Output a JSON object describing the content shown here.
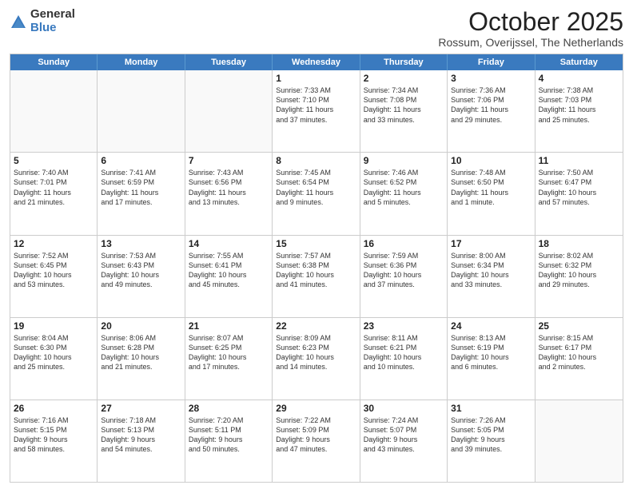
{
  "logo": {
    "general": "General",
    "blue": "Blue"
  },
  "title": "October 2025",
  "location": "Rossum, Overijssel, The Netherlands",
  "header_days": [
    "Sunday",
    "Monday",
    "Tuesday",
    "Wednesday",
    "Thursday",
    "Friday",
    "Saturday"
  ],
  "weeks": [
    [
      {
        "day": "",
        "text": ""
      },
      {
        "day": "",
        "text": ""
      },
      {
        "day": "",
        "text": ""
      },
      {
        "day": "1",
        "text": "Sunrise: 7:33 AM\nSunset: 7:10 PM\nDaylight: 11 hours\nand 37 minutes."
      },
      {
        "day": "2",
        "text": "Sunrise: 7:34 AM\nSunset: 7:08 PM\nDaylight: 11 hours\nand 33 minutes."
      },
      {
        "day": "3",
        "text": "Sunrise: 7:36 AM\nSunset: 7:06 PM\nDaylight: 11 hours\nand 29 minutes."
      },
      {
        "day": "4",
        "text": "Sunrise: 7:38 AM\nSunset: 7:03 PM\nDaylight: 11 hours\nand 25 minutes."
      }
    ],
    [
      {
        "day": "5",
        "text": "Sunrise: 7:40 AM\nSunset: 7:01 PM\nDaylight: 11 hours\nand 21 minutes."
      },
      {
        "day": "6",
        "text": "Sunrise: 7:41 AM\nSunset: 6:59 PM\nDaylight: 11 hours\nand 17 minutes."
      },
      {
        "day": "7",
        "text": "Sunrise: 7:43 AM\nSunset: 6:56 PM\nDaylight: 11 hours\nand 13 minutes."
      },
      {
        "day": "8",
        "text": "Sunrise: 7:45 AM\nSunset: 6:54 PM\nDaylight: 11 hours\nand 9 minutes."
      },
      {
        "day": "9",
        "text": "Sunrise: 7:46 AM\nSunset: 6:52 PM\nDaylight: 11 hours\nand 5 minutes."
      },
      {
        "day": "10",
        "text": "Sunrise: 7:48 AM\nSunset: 6:50 PM\nDaylight: 11 hours\nand 1 minute."
      },
      {
        "day": "11",
        "text": "Sunrise: 7:50 AM\nSunset: 6:47 PM\nDaylight: 10 hours\nand 57 minutes."
      }
    ],
    [
      {
        "day": "12",
        "text": "Sunrise: 7:52 AM\nSunset: 6:45 PM\nDaylight: 10 hours\nand 53 minutes."
      },
      {
        "day": "13",
        "text": "Sunrise: 7:53 AM\nSunset: 6:43 PM\nDaylight: 10 hours\nand 49 minutes."
      },
      {
        "day": "14",
        "text": "Sunrise: 7:55 AM\nSunset: 6:41 PM\nDaylight: 10 hours\nand 45 minutes."
      },
      {
        "day": "15",
        "text": "Sunrise: 7:57 AM\nSunset: 6:38 PM\nDaylight: 10 hours\nand 41 minutes."
      },
      {
        "day": "16",
        "text": "Sunrise: 7:59 AM\nSunset: 6:36 PM\nDaylight: 10 hours\nand 37 minutes."
      },
      {
        "day": "17",
        "text": "Sunrise: 8:00 AM\nSunset: 6:34 PM\nDaylight: 10 hours\nand 33 minutes."
      },
      {
        "day": "18",
        "text": "Sunrise: 8:02 AM\nSunset: 6:32 PM\nDaylight: 10 hours\nand 29 minutes."
      }
    ],
    [
      {
        "day": "19",
        "text": "Sunrise: 8:04 AM\nSunset: 6:30 PM\nDaylight: 10 hours\nand 25 minutes."
      },
      {
        "day": "20",
        "text": "Sunrise: 8:06 AM\nSunset: 6:28 PM\nDaylight: 10 hours\nand 21 minutes."
      },
      {
        "day": "21",
        "text": "Sunrise: 8:07 AM\nSunset: 6:25 PM\nDaylight: 10 hours\nand 17 minutes."
      },
      {
        "day": "22",
        "text": "Sunrise: 8:09 AM\nSunset: 6:23 PM\nDaylight: 10 hours\nand 14 minutes."
      },
      {
        "day": "23",
        "text": "Sunrise: 8:11 AM\nSunset: 6:21 PM\nDaylight: 10 hours\nand 10 minutes."
      },
      {
        "day": "24",
        "text": "Sunrise: 8:13 AM\nSunset: 6:19 PM\nDaylight: 10 hours\nand 6 minutes."
      },
      {
        "day": "25",
        "text": "Sunrise: 8:15 AM\nSunset: 6:17 PM\nDaylight: 10 hours\nand 2 minutes."
      }
    ],
    [
      {
        "day": "26",
        "text": "Sunrise: 7:16 AM\nSunset: 5:15 PM\nDaylight: 9 hours\nand 58 minutes."
      },
      {
        "day": "27",
        "text": "Sunrise: 7:18 AM\nSunset: 5:13 PM\nDaylight: 9 hours\nand 54 minutes."
      },
      {
        "day": "28",
        "text": "Sunrise: 7:20 AM\nSunset: 5:11 PM\nDaylight: 9 hours\nand 50 minutes."
      },
      {
        "day": "29",
        "text": "Sunrise: 7:22 AM\nSunset: 5:09 PM\nDaylight: 9 hours\nand 47 minutes."
      },
      {
        "day": "30",
        "text": "Sunrise: 7:24 AM\nSunset: 5:07 PM\nDaylight: 9 hours\nand 43 minutes."
      },
      {
        "day": "31",
        "text": "Sunrise: 7:26 AM\nSunset: 5:05 PM\nDaylight: 9 hours\nand 39 minutes."
      },
      {
        "day": "",
        "text": ""
      }
    ]
  ]
}
